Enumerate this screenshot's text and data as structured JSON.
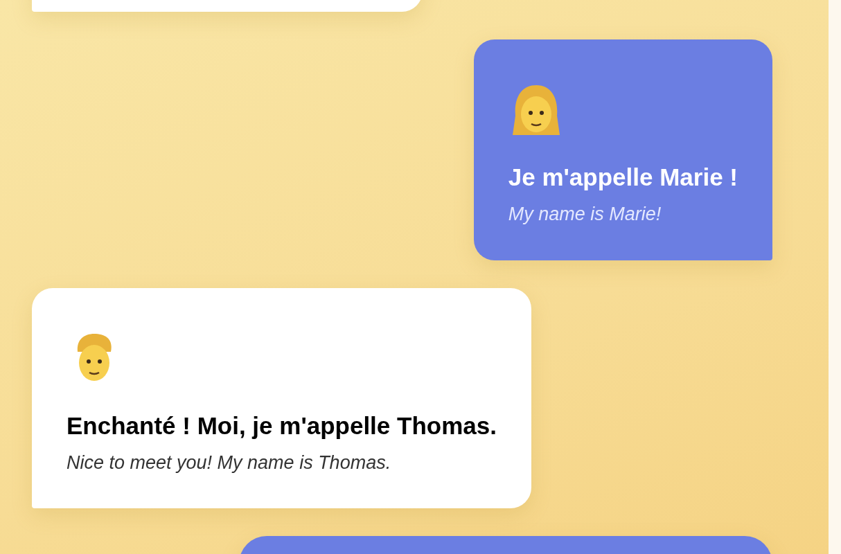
{
  "messages": [
    {
      "kind": "stub",
      "outgoing": false
    },
    {
      "kind": "woman",
      "outgoing": true,
      "text": "Je m'appelle Marie !",
      "translation": "My name is Marie!"
    },
    {
      "kind": "man",
      "outgoing": false,
      "text": "Enchanté ! Moi, je m'appelle Thomas.",
      "translation": "Nice to meet you! My name is Thomas."
    },
    {
      "kind": "stub",
      "outgoing": true
    }
  ]
}
